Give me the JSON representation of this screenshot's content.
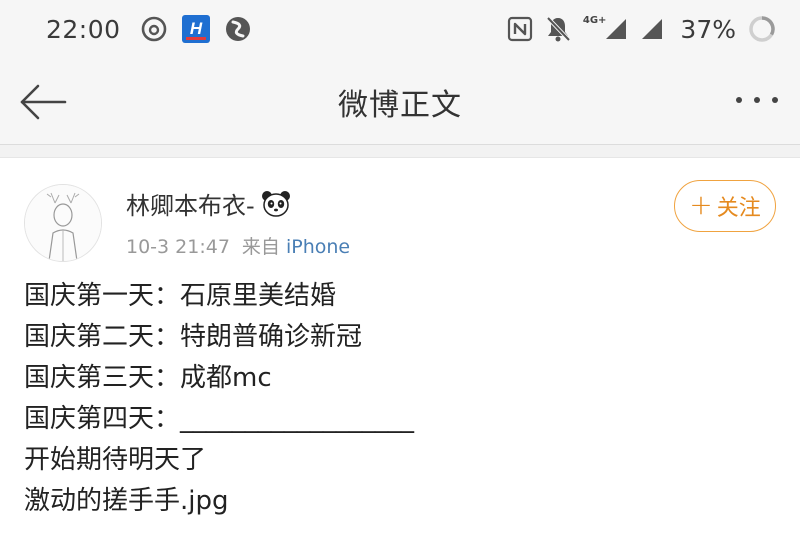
{
  "status_bar": {
    "time": "22:00",
    "battery_percent": "37%",
    "network_tag": "4G+",
    "icons": [
      "netease-music-icon",
      "hupu-app-icon",
      "app-swirl-icon",
      "nfc-icon",
      "mute-icon",
      "signal-4g-icon",
      "signal-icon",
      "battery-ring-icon"
    ]
  },
  "nav": {
    "title": "微博正文",
    "back_icon": "back-arrow-icon",
    "more_icon": "more-icon"
  },
  "post": {
    "username": "林卿本布衣-",
    "username_emoji": "panda-emoji-icon",
    "time": "10-3 21:47",
    "source_prefix": "来自",
    "source": "iPhone",
    "follow_label": "关注",
    "follow_plus": "+",
    "lines": [
      "国庆第一天：石原里美结婚",
      "国庆第二天：特朗普确诊新冠",
      "国庆第三天：成都mc",
      "国庆第四天：__________________",
      "开始期待明天了",
      "激动的搓手手.jpg"
    ]
  },
  "colors": {
    "follow_accent": "#e58a1f",
    "link": "#4a7fb5",
    "meta_gray": "#999999",
    "bar_bg": "#f6f6f6"
  }
}
